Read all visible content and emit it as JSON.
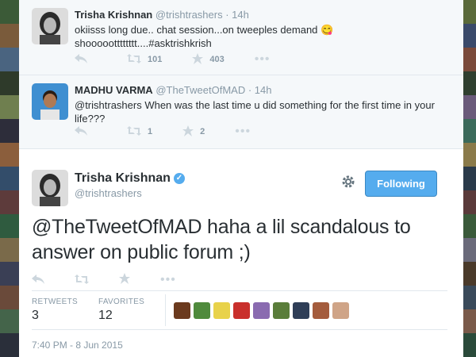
{
  "context_tweets": [
    {
      "name": "Trisha Krishnan",
      "handle": "@trishtrashers",
      "time": "· 14h",
      "text": "okiisss long due.. chat session...on tweeples demand 😋 shoooootttttttt....#asktrishkrish",
      "retweets": "101",
      "favorites": "403",
      "avatar_color": "#3a3a3a"
    },
    {
      "name": "MADHU VARMA",
      "handle": "@TheTweetOfMAD",
      "time": "· 14h",
      "text": "@trishtrashers When was the last time u did something for the first time in your life???",
      "retweets": "1",
      "favorites": "2",
      "avatar_color": "#2a7ac0"
    }
  ],
  "main_tweet": {
    "name": "Trisha Krishnan",
    "handle": "@trishtrashers",
    "follow_label": "Following",
    "text": "@TheTweetOfMAD haha a lil scandalous to answer on public forum ;)",
    "retweets_label": "RETWEETS",
    "retweets": "3",
    "favorites_label": "FAVORITES",
    "favorites": "12",
    "timestamp": "7:40 PM - 8 Jun 2015"
  },
  "icons": {
    "reply": "reply-icon",
    "retweet": "retweet-icon",
    "favorite": "star-icon",
    "more": "more-icon",
    "gear": "gear-icon",
    "verified": "verified-badge-icon"
  },
  "colors": {
    "accent": "#55acee",
    "text": "#292f33",
    "muted": "#8899a6",
    "context_bg": "#f5f8fa"
  },
  "favoriter_colors": [
    "#6b3a1e",
    "#4f8a3c",
    "#e8d24a",
    "#c9302c",
    "#8a6bb0",
    "#5a7d3a",
    "#2f3e57",
    "#a45c3d",
    "#cfa487"
  ]
}
